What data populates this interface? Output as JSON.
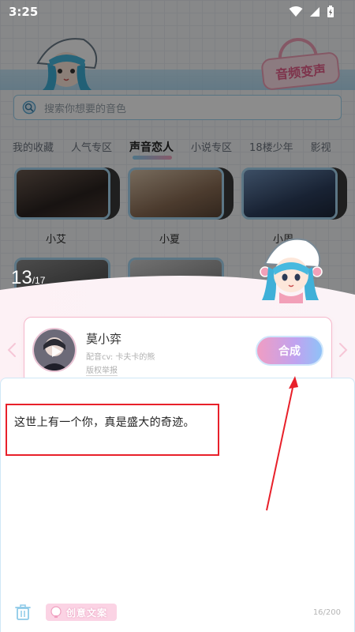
{
  "status_bar": {
    "time": "3:25"
  },
  "banner": {
    "voice_change_label": "音频变声"
  },
  "search": {
    "placeholder": "搜索你想要的音色"
  },
  "tabs": [
    {
      "label": "我的收藏"
    },
    {
      "label": "人气专区"
    },
    {
      "label": "声音恋人",
      "active": true
    },
    {
      "label": "小说专区"
    },
    {
      "label": "18楼少年"
    },
    {
      "label": "影视"
    }
  ],
  "cards": [
    {
      "name": "小艾"
    },
    {
      "name": "小夏"
    },
    {
      "name": "小周"
    }
  ],
  "counter": {
    "current": "13",
    "total": "/17"
  },
  "voice": {
    "name": "莫小弈",
    "cv": "配音cv: 卡夫卡的熊",
    "report": "版权举报",
    "synth_label": "合成"
  },
  "editor": {
    "text": "这世上有一个你，真是盛大的奇迹。",
    "creative_label": "创意文案",
    "char_count": "16/200"
  },
  "colors": {
    "accent_pink": "#f5b8cb",
    "accent_blue": "#a8d8f2",
    "highlight_red": "#e8202a"
  }
}
